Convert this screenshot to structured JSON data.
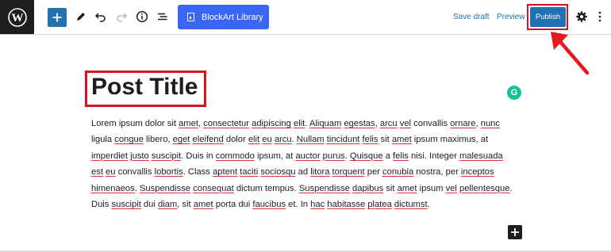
{
  "toolbar": {
    "blockart_label": "BlockArt Library",
    "save_draft": "Save draft",
    "preview": "Preview",
    "publish": "Publish"
  },
  "post": {
    "title": "Post Title",
    "grammarly_letter": "G",
    "paragraph_lines": [
      [
        {
          "t": "Lorem ipsum dolor sit ",
          "u": false
        },
        {
          "t": "amet",
          "u": true
        },
        {
          "t": ", ",
          "u": false
        },
        {
          "t": "consectetur",
          "u": true
        },
        {
          "t": " ",
          "u": false
        },
        {
          "t": "adipiscing",
          "u": true
        },
        {
          "t": " ",
          "u": false
        },
        {
          "t": "elit",
          "u": true
        },
        {
          "t": ". ",
          "u": false
        },
        {
          "t": "Aliquam",
          "u": true
        },
        {
          "t": " ",
          "u": false
        },
        {
          "t": "egestas",
          "u": true
        },
        {
          "t": ", ",
          "u": false
        },
        {
          "t": "arcu",
          "u": true
        },
        {
          "t": " ",
          "u": false
        },
        {
          "t": "vel",
          "u": true
        },
        {
          "t": " convallis ",
          "u": false
        },
        {
          "t": "ornare",
          "u": true
        },
        {
          "t": ", ",
          "u": false
        },
        {
          "t": "nunc",
          "u": true
        }
      ],
      [
        {
          "t": "ligula ",
          "u": false
        },
        {
          "t": "congue",
          "u": true
        },
        {
          "t": " libero, ",
          "u": false
        },
        {
          "t": "eget",
          "u": true
        },
        {
          "t": " ",
          "u": false
        },
        {
          "t": "eleifend",
          "u": true
        },
        {
          "t": " dolor ",
          "u": false
        },
        {
          "t": "elit",
          "u": true
        },
        {
          "t": " ",
          "u": false
        },
        {
          "t": "eu",
          "u": true
        },
        {
          "t": " ",
          "u": false
        },
        {
          "t": "arcu",
          "u": true
        },
        {
          "t": ". ",
          "u": false
        },
        {
          "t": "Nullam",
          "u": true
        },
        {
          "t": " ",
          "u": false
        },
        {
          "t": "tincidunt",
          "u": true
        },
        {
          "t": " ",
          "u": false
        },
        {
          "t": "felis",
          "u": true
        },
        {
          "t": " sit ",
          "u": false
        },
        {
          "t": "amet",
          "u": true
        },
        {
          "t": " ipsum maximus, at",
          "u": false
        }
      ],
      [
        {
          "t": "imperdiet",
          "u": true
        },
        {
          "t": " ",
          "u": false
        },
        {
          "t": "justo",
          "u": true
        },
        {
          "t": " ",
          "u": false
        },
        {
          "t": "suscipit",
          "u": true
        },
        {
          "t": ". Duis in ",
          "u": false
        },
        {
          "t": "commodo",
          "u": true
        },
        {
          "t": " ipsum, at ",
          "u": false
        },
        {
          "t": "auctor",
          "u": true
        },
        {
          "t": " ",
          "u": false
        },
        {
          "t": "purus",
          "u": true
        },
        {
          "t": ". ",
          "u": false
        },
        {
          "t": "Quisque",
          "u": true
        },
        {
          "t": " a ",
          "u": false
        },
        {
          "t": "felis",
          "u": true
        },
        {
          "t": " nisi. Integer ",
          "u": false
        },
        {
          "t": "malesuada",
          "u": true
        }
      ],
      [
        {
          "t": "est",
          "u": true
        },
        {
          "t": " ",
          "u": false
        },
        {
          "t": "eu",
          "u": true
        },
        {
          "t": " convallis ",
          "u": false
        },
        {
          "t": "lobortis",
          "u": true
        },
        {
          "t": ". Class ",
          "u": false
        },
        {
          "t": "aptent",
          "u": true
        },
        {
          "t": " ",
          "u": false
        },
        {
          "t": "taciti",
          "u": true
        },
        {
          "t": " ",
          "u": false
        },
        {
          "t": "sociosqu",
          "u": true
        },
        {
          "t": " ad ",
          "u": false
        },
        {
          "t": "litora",
          "u": true
        },
        {
          "t": " ",
          "u": false
        },
        {
          "t": "torquent",
          "u": true
        },
        {
          "t": " per ",
          "u": false
        },
        {
          "t": "conubia",
          "u": true
        },
        {
          "t": " nostra, per ",
          "u": false
        },
        {
          "t": "inceptos",
          "u": true
        }
      ],
      [
        {
          "t": "himenaeos",
          "u": true
        },
        {
          "t": ". ",
          "u": false
        },
        {
          "t": "Suspendisse",
          "u": true
        },
        {
          "t": " ",
          "u": false
        },
        {
          "t": "consequat",
          "u": true
        },
        {
          "t": " dictum tempus. ",
          "u": false
        },
        {
          "t": "Suspendisse",
          "u": true
        },
        {
          "t": " ",
          "u": false
        },
        {
          "t": "dapibus",
          "u": true
        },
        {
          "t": " sit ",
          "u": false
        },
        {
          "t": "amet",
          "u": true
        },
        {
          "t": " ipsum ",
          "u": false
        },
        {
          "t": "vel",
          "u": true
        },
        {
          "t": " ",
          "u": false
        },
        {
          "t": "pellentesque",
          "u": true
        },
        {
          "t": ".",
          "u": false
        }
      ],
      [
        {
          "t": "Duis ",
          "u": false
        },
        {
          "t": "suscipit",
          "u": true
        },
        {
          "t": " dui ",
          "u": false
        },
        {
          "t": "diam",
          "u": true
        },
        {
          "t": ", sit ",
          "u": false
        },
        {
          "t": "amet",
          "u": true
        },
        {
          "t": " porta dui ",
          "u": false
        },
        {
          "t": "faucibus",
          "u": true
        },
        {
          "t": " et. In ",
          "u": false
        },
        {
          "t": "hac",
          "u": true
        },
        {
          "t": " ",
          "u": false
        },
        {
          "t": "habitasse",
          "u": true
        },
        {
          "t": " ",
          "u": false
        },
        {
          "t": "platea",
          "u": true
        },
        {
          "t": " ",
          "u": false
        },
        {
          "t": "dictumst",
          "u": true
        },
        {
          "t": ".",
          "u": false
        }
      ]
    ]
  },
  "colors": {
    "accent": "#2271b1",
    "blockart": "#3b66f5",
    "highlight_red": "#d6121e",
    "dark": "#1e1e1e",
    "grammarly": "#15c39a"
  },
  "icons": [
    "wordpress-logo-icon",
    "plus-icon",
    "pencil-icon",
    "undo-icon",
    "redo-icon",
    "info-icon",
    "list-view-icon",
    "gear-icon",
    "more-vertical-icon",
    "grammarly-icon",
    "arrow-icon"
  ]
}
